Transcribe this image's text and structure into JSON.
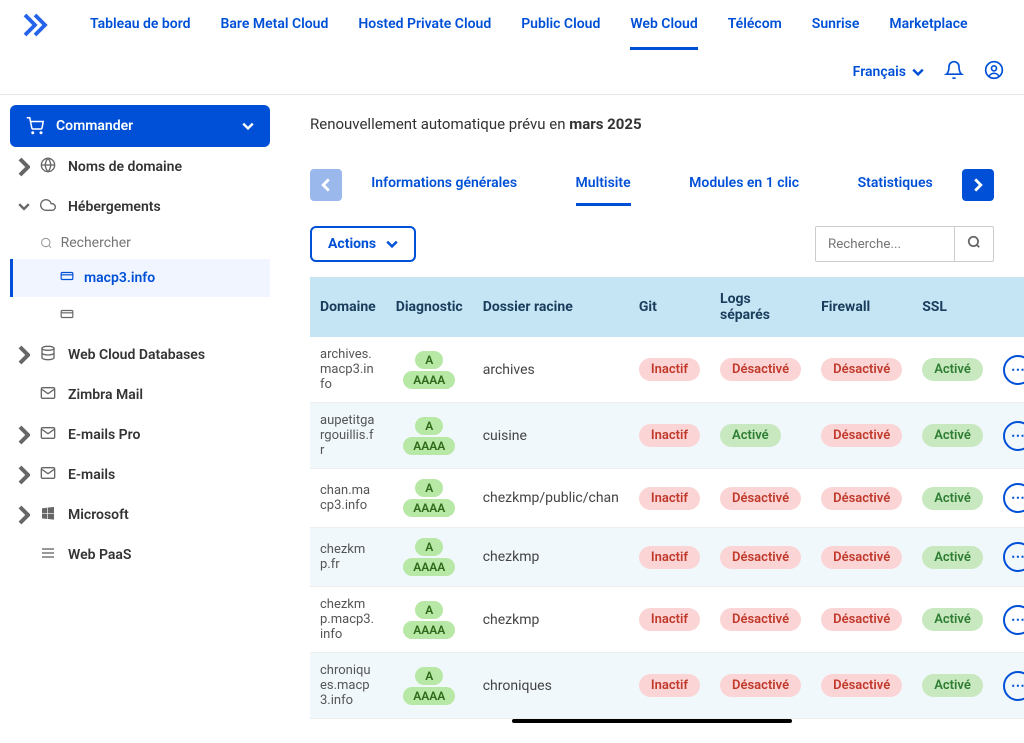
{
  "topnav": {
    "items": [
      "Tableau de bord",
      "Bare Metal Cloud",
      "Hosted Private Cloud",
      "Public Cloud",
      "Web Cloud",
      "Télécom",
      "Sunrise",
      "Marketplace"
    ],
    "active_index": 4
  },
  "subheader": {
    "language": "Français"
  },
  "sidebar": {
    "order": "Commander",
    "items": [
      {
        "label": "Noms de domaine",
        "icon": "globe",
        "expanded": false,
        "children": []
      },
      {
        "label": "Hébergements",
        "icon": "cloud",
        "expanded": true,
        "children": [
          {
            "label": "macp3.info",
            "active": true
          },
          {
            "label": "",
            "active": false
          }
        ]
      },
      {
        "label": "Web Cloud Databases",
        "icon": "db",
        "expanded": false,
        "children": []
      },
      {
        "label": "Zimbra Mail",
        "icon": "mail",
        "expanded": false,
        "no_chev": true
      },
      {
        "label": "E-mails Pro",
        "icon": "mail",
        "expanded": false,
        "children": []
      },
      {
        "label": "E-mails",
        "icon": "mail",
        "expanded": false,
        "children": []
      },
      {
        "label": "Microsoft",
        "icon": "windows",
        "expanded": false,
        "children": []
      },
      {
        "label": "Web PaaS",
        "icon": "menu",
        "expanded": false,
        "no_chev": true
      }
    ],
    "search_placeholder": "Rechercher"
  },
  "main": {
    "renewal_prefix": "Renouvellement automatique prévu en ",
    "renewal_date": "mars 2025",
    "tabs": [
      "Informations générales",
      "Multisite",
      "Modules en 1 clic",
      "Statistiques"
    ],
    "active_tab_index": 1,
    "actions_label": "Actions",
    "search_placeholder": "Recherche...",
    "columns": [
      "Domaine",
      "Diagnostic",
      "Dossier racine",
      "Git",
      "Logs séparés",
      "Firewall",
      "SSL"
    ],
    "badge_labels": {
      "a": "A",
      "aaaa": "AAAA"
    },
    "pill_labels": {
      "inactive": "Inactif",
      "disabled": "Désactivé",
      "active": "Activé"
    },
    "rows": [
      {
        "domain": "archives.macp3.info",
        "folder": "archives",
        "git": "inactive",
        "logs": "disabled",
        "firewall": "disabled",
        "ssl": "active"
      },
      {
        "domain": "aupetitgargouillis.fr",
        "folder": "cuisine",
        "git": "inactive",
        "logs": "active",
        "firewall": "disabled",
        "ssl": "active"
      },
      {
        "domain": "chan.macp3.info",
        "folder": "chezkmp/public/chan",
        "git": "inactive",
        "logs": "disabled",
        "firewall": "disabled",
        "ssl": "active"
      },
      {
        "domain": "chezkmp.fr",
        "folder": "chezkmp",
        "git": "inactive",
        "logs": "disabled",
        "firewall": "disabled",
        "ssl": "active"
      },
      {
        "domain": "chezkmp.macp3.info",
        "folder": "chezkmp",
        "git": "inactive",
        "logs": "disabled",
        "firewall": "disabled",
        "ssl": "active"
      },
      {
        "domain": "chroniques.macp3.info",
        "folder": "chroniques",
        "git": "inactive",
        "logs": "disabled",
        "firewall": "disabled",
        "ssl": "active"
      }
    ]
  }
}
